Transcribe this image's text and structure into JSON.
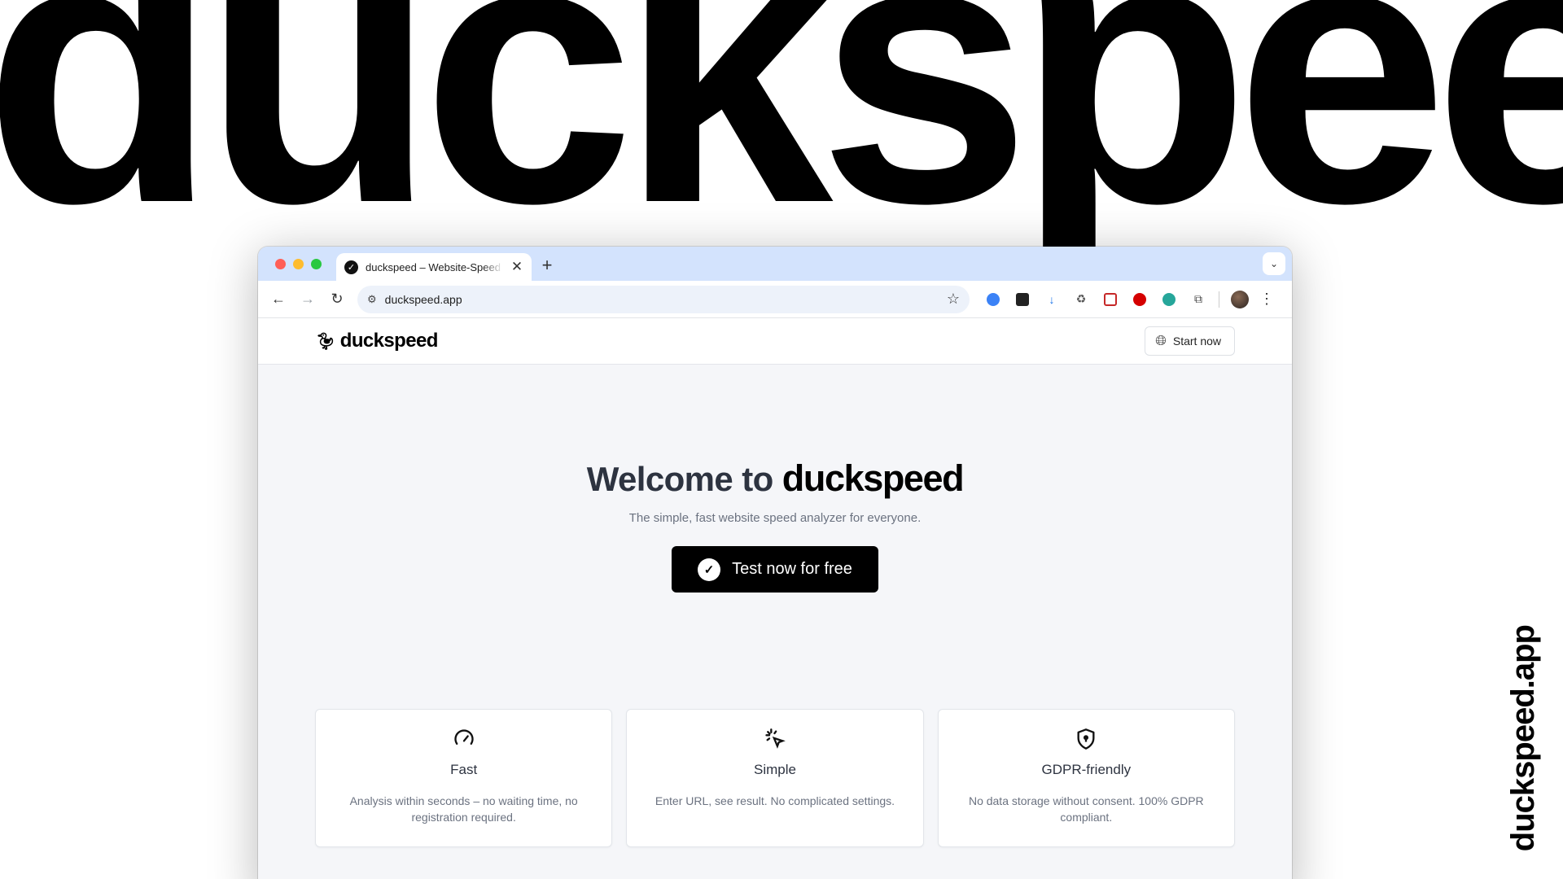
{
  "background": {
    "wordmark": "duckspeed",
    "side_url": "duckspeed.app"
  },
  "browser": {
    "tab_title": "duckspeed – Website-Speed",
    "tab_close": "✕",
    "new_tab": "+",
    "tab_menu": "⌄",
    "url": "duckspeed.app",
    "back": "←",
    "forward": "→",
    "reload": "↻",
    "star": "☆",
    "kebab": "⋮",
    "extension_icons": [
      "vpn-icon",
      "clipboard-icon",
      "download-icon",
      "recycle-icon",
      "media-icon",
      "adblock-icon",
      "info-icon",
      "puzzle-icon"
    ]
  },
  "site": {
    "logo_text": "duckspeed",
    "start_button": "Start now"
  },
  "hero": {
    "title_prefix": "Welcome to",
    "title_brand": "duckspeed",
    "subtitle": "The simple, fast website speed analyzer for everyone.",
    "cta_label": "Test now for free"
  },
  "features": [
    {
      "icon": "speedometer-icon",
      "title": "Fast",
      "description": "Analysis within seconds – no waiting time, no registration required."
    },
    {
      "icon": "cursor-click-icon",
      "title": "Simple",
      "description": "Enter URL, see result. No complicated settings."
    },
    {
      "icon": "shield-lock-icon",
      "title": "GDPR-friendly",
      "description": "No data storage without consent. 100% GDPR compliant."
    }
  ],
  "colors": {
    "tabstrip": "#d3e3fd",
    "page_bg": "#f5f6f9",
    "cta_bg": "#000000",
    "heading": "#2d3340",
    "muted": "#6b7280"
  }
}
